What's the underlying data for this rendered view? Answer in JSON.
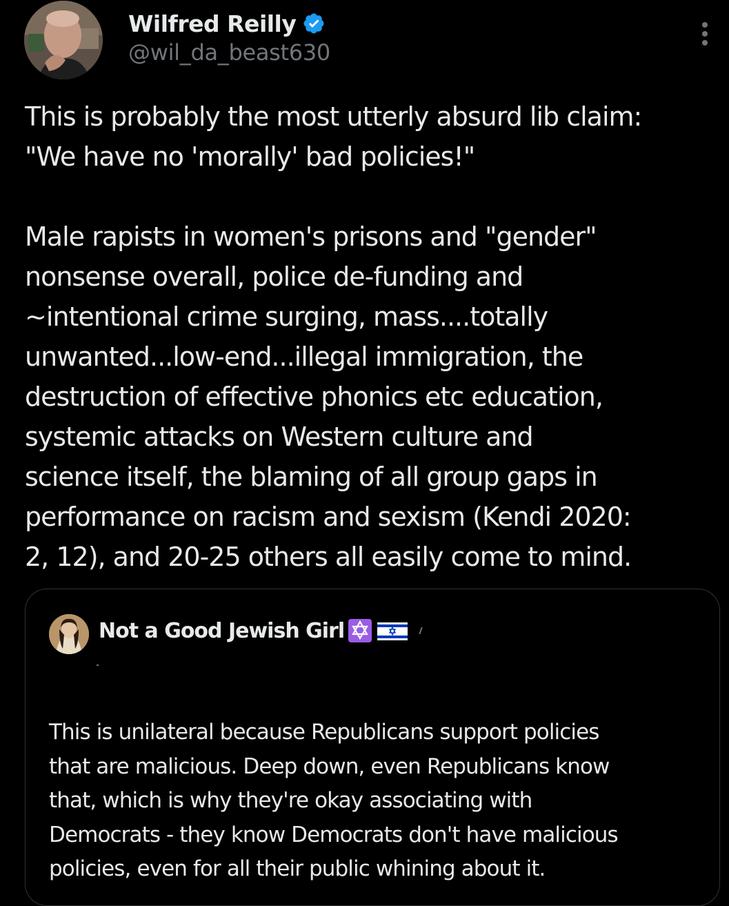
{
  "tweet": {
    "author": {
      "name": "Wilfred Reilly",
      "handle": "@wil_da_beast630",
      "verified": true
    },
    "more_icon": "more-vertical-icon",
    "body_paragraphs": [
      "This is probably the most utterly absurd lib claim:\n\"We have no 'morally' bad policies!\"",
      "Male rapists in women's prisons and \"gender\"\nnonsense overall, police de-funding and\n~intentional crime surging, mass....totally\nunwanted...low-end...illegal immigration, the\ndestruction of effective phonics etc education,\nsystemic attacks on Western culture and\nscience itself, the blaming of all group gaps in\nperformance on racism and sexism (Kendi 2020:\n2, 12), and 20-25 others all easily come to mind."
    ]
  },
  "quoted_tweet": {
    "author": {
      "name": "Not a Good Jewish Girl",
      "emoji_icons": [
        "star-of-david-icon",
        "israel-flag-icon"
      ]
    },
    "body": "This is unilateral because Republicans support policies\nthat are malicious. Deep down, even Republicans know\nthat, which is why they're okay associating with\nDemocrats - they know Democrats don't have malicious\npolicies, even for all their public whining about it."
  },
  "colors": {
    "background": "#000000",
    "text_primary": "#e7e9ea",
    "text_secondary": "#71767b",
    "border": "#2f3336",
    "verified_blue": "#1d9bf0"
  }
}
